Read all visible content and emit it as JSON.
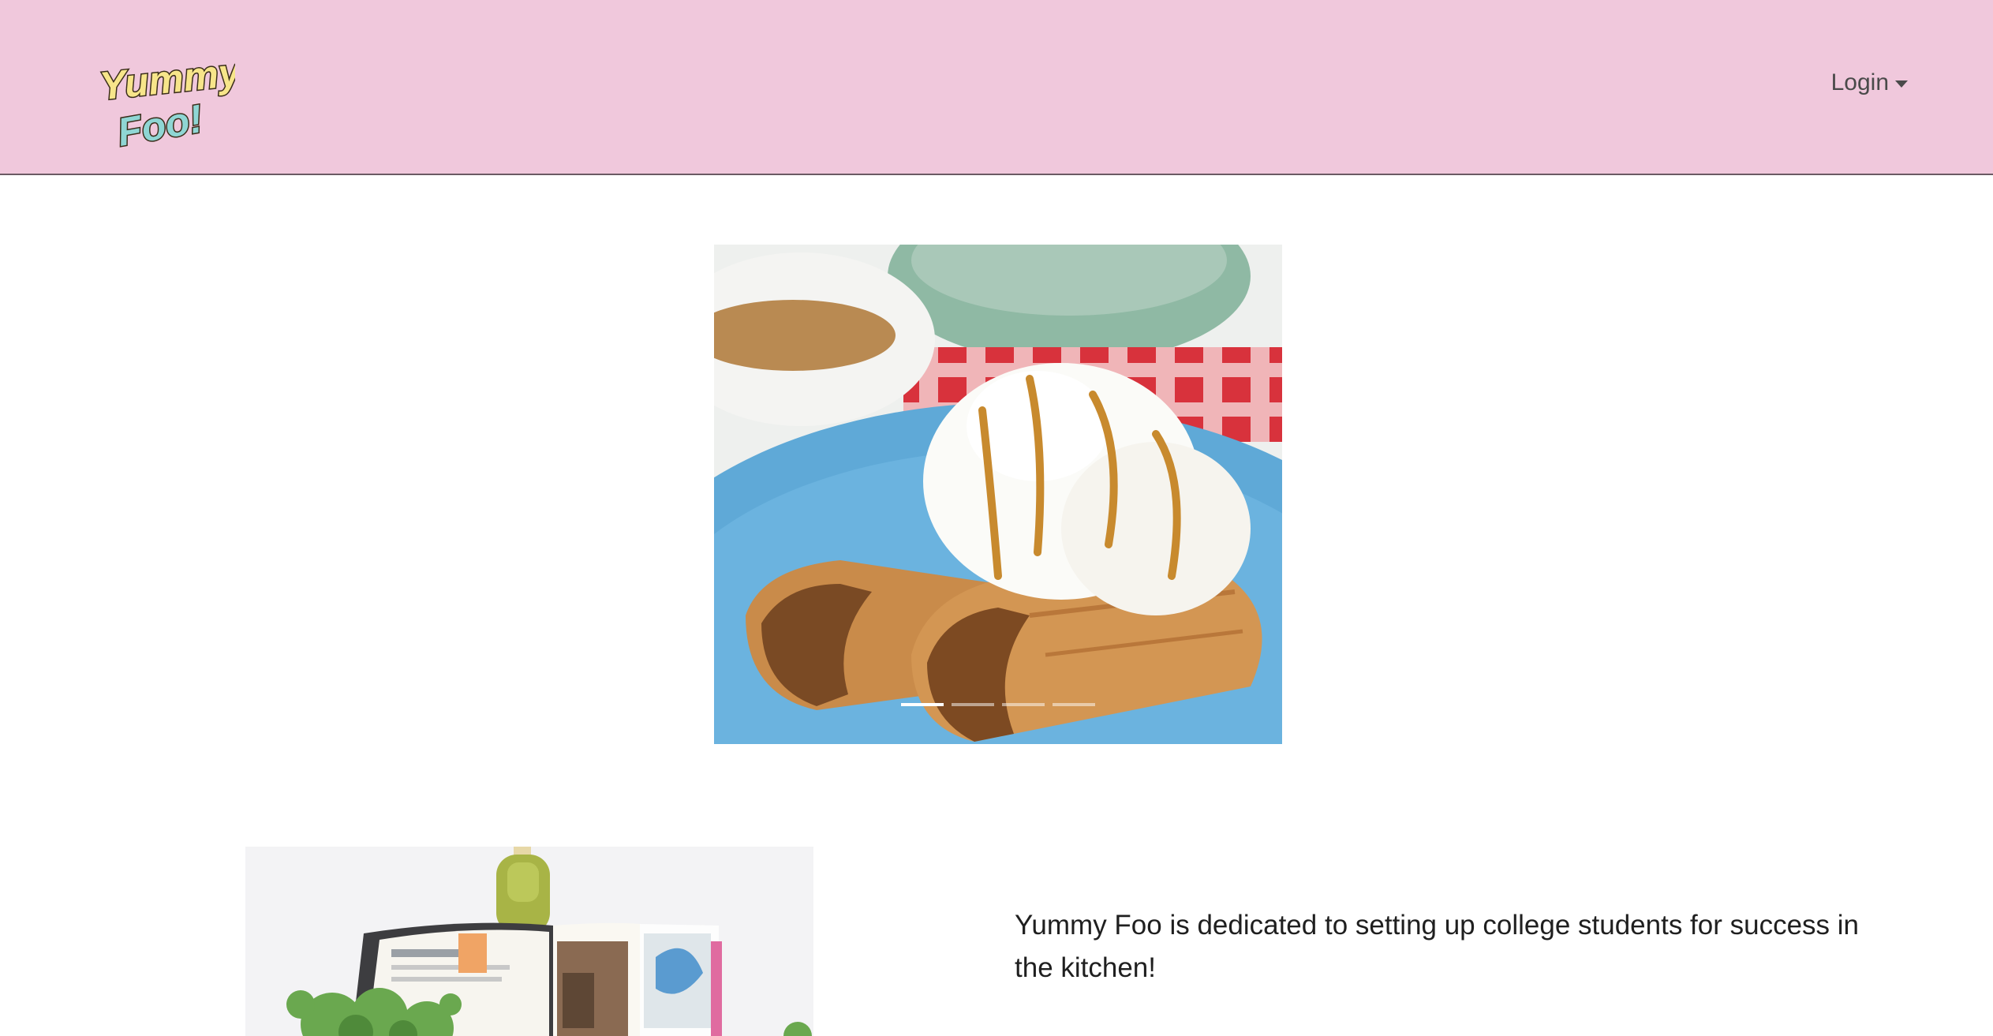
{
  "header": {
    "logo": {
      "line1": "Yummy",
      "line2": "Foo!"
    },
    "login_label": "Login"
  },
  "carousel": {
    "active_index": 0,
    "slide_count": 4,
    "slide_description": "dessert lumpia with vanilla ice cream and caramel drizzle"
  },
  "about": {
    "image_description": "open cookbook with greens and a spatula",
    "tagline": "Yummy Foo is dedicated to setting up college students for success in the kitchen!"
  },
  "colors": {
    "navbar_bg": "#f0c8dc",
    "text": "#212529"
  }
}
